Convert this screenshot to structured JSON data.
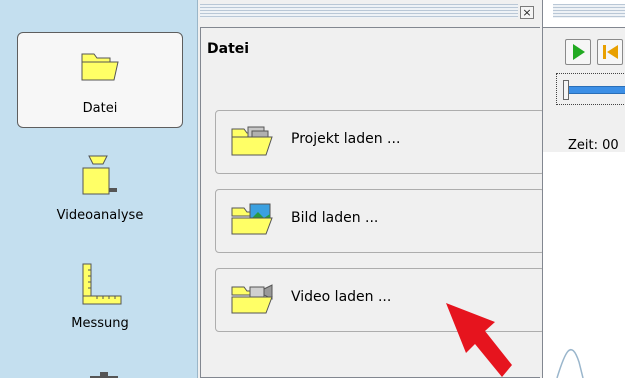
{
  "sidebar": {
    "items": [
      {
        "label": "Datei",
        "icon": "folder-icon"
      },
      {
        "label": "Videoanalyse",
        "icon": "camera-icon"
      },
      {
        "label": "Messung",
        "icon": "ruler-icon"
      }
    ]
  },
  "panel": {
    "title": "Datei",
    "close_label": "×",
    "actions": [
      {
        "label": "Projekt laden ...",
        "icon": "open-project-icon"
      },
      {
        "label": "Bild laden ...",
        "icon": "open-image-icon"
      },
      {
        "label": "Video laden ...",
        "icon": "open-video-icon"
      }
    ]
  },
  "right": {
    "time_label": "Zeit:  00"
  },
  "colors": {
    "sidebar_bg": "#c4dfef",
    "folder_yellow": "#ffff66",
    "play_green": "#22aa22",
    "slider_blue": "#3c8fe6",
    "arrow_red": "#e6141e"
  }
}
